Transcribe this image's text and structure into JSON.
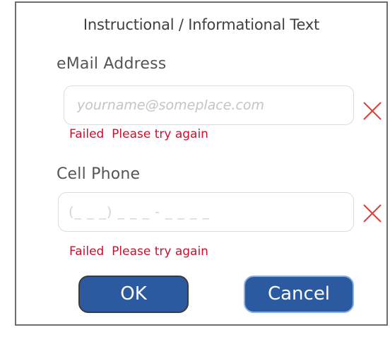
{
  "dialog": {
    "instruction_text": "Instructional / Informational Text"
  },
  "email": {
    "label": "eMail Address",
    "placeholder": "yourname@someplace.com",
    "value": "",
    "error": "Failed  Please try again",
    "status_icon": "close-icon"
  },
  "phone": {
    "label": "Cell Phone",
    "placeholder": "(_ _ _) _ _ _ - _ _ _ _",
    "value": "",
    "error": "Failed  Please try again",
    "status_icon": "close-icon"
  },
  "buttons": {
    "ok_label": "OK",
    "cancel_label": "Cancel"
  },
  "colors": {
    "error": "#c8102e",
    "button": "#2b5aa0",
    "error_icon": "#e0403a"
  }
}
